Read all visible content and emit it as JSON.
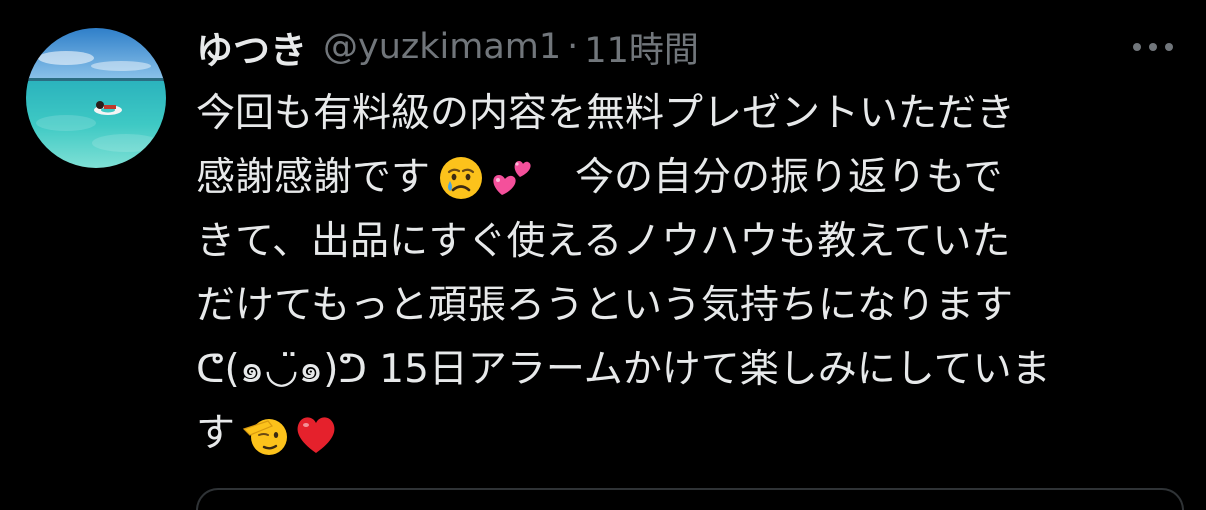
{
  "tweet": {
    "author": {
      "display_name": "ゆつき",
      "handle": "@yuzkimam1",
      "separator": "·",
      "time": "11時間",
      "avatar_icon": "avatar-beach-photo"
    },
    "more_icon": "more-horizontal-icon",
    "lines": [
      {
        "text": "今回も有料級の内容を無料プレゼントいただき"
      },
      {
        "text": "感謝感謝です",
        "emojis": [
          "crying-face-emoji",
          "two-hearts-emoji"
        ],
        "after": "　今の自分の振り返りもで"
      },
      {
        "text": "きて、出品にすぐ使えるノウハウも教えていた"
      },
      {
        "text": "だけてもっと頑張ろうという気持ちになります"
      },
      {
        "text": "ᕦ(๑◡̈๑)ᕤ 15日アラームかけて楽しみにしていま"
      },
      {
        "text": "す",
        "emojis": [
          "saluting-face-emoji",
          "red-heart-emoji"
        ]
      }
    ]
  },
  "colors": {
    "background": "#000000",
    "text_primary": "#e7e9ea",
    "text_secondary": "#71767b",
    "border": "#2f3336"
  }
}
